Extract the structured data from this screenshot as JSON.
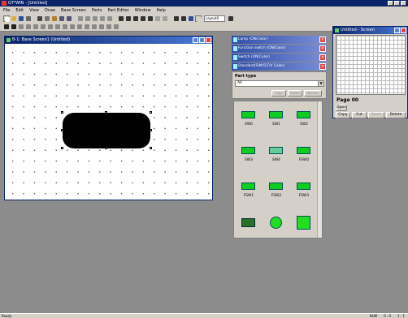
{
  "app": {
    "title": "GT*WIN - [Untitled]"
  },
  "menubar": [
    "File",
    "Edit",
    "View",
    "Draw",
    "Base Screen",
    "Parts",
    "Part Editor",
    "Window",
    "Help"
  ],
  "toolbar": {
    "combo_value": "Layout0"
  },
  "base_window": {
    "title": "B-1: Base Screen1 (Untitled)"
  },
  "tool_windows": [
    "Lamp (ON/Color)",
    "Function switch (ON/Color)",
    "Switch (ON/Color)",
    "Standard(SIM/5/T/V Color)"
  ],
  "parts_panel": {
    "label": "Part type",
    "selected": "All",
    "buttons": [
      "Copy",
      "Delete",
      "Rename"
    ]
  },
  "palette": {
    "items": [
      {
        "label": "SW0",
        "kind": "switch"
      },
      {
        "label": "SW1",
        "kind": "switch"
      },
      {
        "label": "SW2",
        "kind": "switch"
      },
      {
        "label": "SW3",
        "kind": "switch"
      },
      {
        "label": "SW4",
        "kind": "switch-gray"
      },
      {
        "label": "FSW0",
        "kind": "switch"
      },
      {
        "label": "FSW1",
        "kind": "switch"
      },
      {
        "label": "FSW2",
        "kind": "switch"
      },
      {
        "label": "FSW3",
        "kind": "switch"
      },
      {
        "label": "",
        "kind": "block"
      },
      {
        "label": "",
        "kind": "lamp"
      },
      {
        "label": "",
        "kind": "square"
      }
    ]
  },
  "sheet_window": {
    "title": "Untitled - Screen",
    "page_label": "Page 00",
    "buttons": {
      "open": "Open",
      "copy": "Copy",
      "cut": "Cut",
      "paste": "Paste",
      "delete": "Delete"
    }
  },
  "status": {
    "left": "Ready",
    "right": [
      "NUM",
      "0 , 0",
      "1 : 1"
    ]
  },
  "colors": {
    "titlebar": "#0a246a",
    "face": "#d4d0c8",
    "desktop": "#8c8c8c",
    "part_green": "#11cc22"
  }
}
